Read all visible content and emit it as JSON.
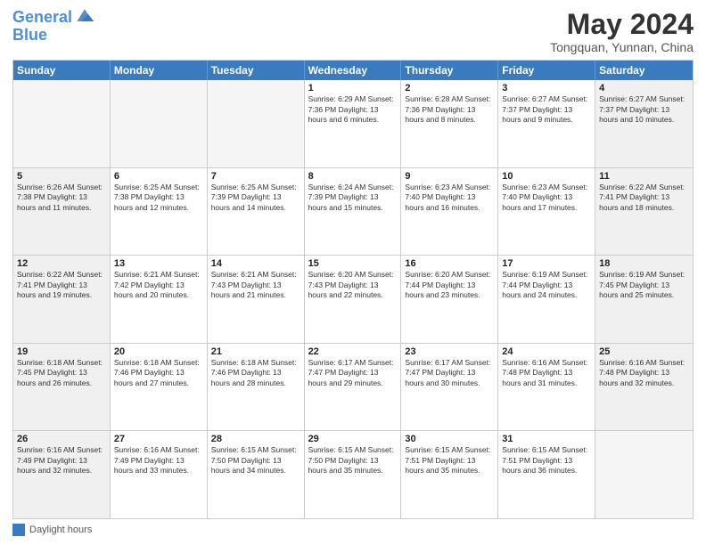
{
  "logo": {
    "line1": "General",
    "line2": "Blue"
  },
  "title": "May 2024",
  "location": "Tongquan, Yunnan, China",
  "header_days": [
    "Sunday",
    "Monday",
    "Tuesday",
    "Wednesday",
    "Thursday",
    "Friday",
    "Saturday"
  ],
  "footer": {
    "legend_label": "Daylight hours"
  },
  "weeks": [
    {
      "cells": [
        {
          "day": "",
          "content": "",
          "empty": true
        },
        {
          "day": "",
          "content": "",
          "empty": true
        },
        {
          "day": "",
          "content": "",
          "empty": true
        },
        {
          "day": "1",
          "content": "Sunrise: 6:29 AM\nSunset: 7:36 PM\nDaylight: 13 hours\nand 6 minutes.",
          "empty": false
        },
        {
          "day": "2",
          "content": "Sunrise: 6:28 AM\nSunset: 7:36 PM\nDaylight: 13 hours\nand 8 minutes.",
          "empty": false
        },
        {
          "day": "3",
          "content": "Sunrise: 6:27 AM\nSunset: 7:37 PM\nDaylight: 13 hours\nand 9 minutes.",
          "empty": false
        },
        {
          "day": "4",
          "content": "Sunrise: 6:27 AM\nSunset: 7:37 PM\nDaylight: 13 hours\nand 10 minutes.",
          "empty": false
        }
      ]
    },
    {
      "cells": [
        {
          "day": "5",
          "content": "Sunrise: 6:26 AM\nSunset: 7:38 PM\nDaylight: 13 hours\nand 11 minutes.",
          "empty": false
        },
        {
          "day": "6",
          "content": "Sunrise: 6:25 AM\nSunset: 7:38 PM\nDaylight: 13 hours\nand 12 minutes.",
          "empty": false
        },
        {
          "day": "7",
          "content": "Sunrise: 6:25 AM\nSunset: 7:39 PM\nDaylight: 13 hours\nand 14 minutes.",
          "empty": false
        },
        {
          "day": "8",
          "content": "Sunrise: 6:24 AM\nSunset: 7:39 PM\nDaylight: 13 hours\nand 15 minutes.",
          "empty": false
        },
        {
          "day": "9",
          "content": "Sunrise: 6:23 AM\nSunset: 7:40 PM\nDaylight: 13 hours\nand 16 minutes.",
          "empty": false
        },
        {
          "day": "10",
          "content": "Sunrise: 6:23 AM\nSunset: 7:40 PM\nDaylight: 13 hours\nand 17 minutes.",
          "empty": false
        },
        {
          "day": "11",
          "content": "Sunrise: 6:22 AM\nSunset: 7:41 PM\nDaylight: 13 hours\nand 18 minutes.",
          "empty": false
        }
      ]
    },
    {
      "cells": [
        {
          "day": "12",
          "content": "Sunrise: 6:22 AM\nSunset: 7:41 PM\nDaylight: 13 hours\nand 19 minutes.",
          "empty": false
        },
        {
          "day": "13",
          "content": "Sunrise: 6:21 AM\nSunset: 7:42 PM\nDaylight: 13 hours\nand 20 minutes.",
          "empty": false
        },
        {
          "day": "14",
          "content": "Sunrise: 6:21 AM\nSunset: 7:43 PM\nDaylight: 13 hours\nand 21 minutes.",
          "empty": false
        },
        {
          "day": "15",
          "content": "Sunrise: 6:20 AM\nSunset: 7:43 PM\nDaylight: 13 hours\nand 22 minutes.",
          "empty": false
        },
        {
          "day": "16",
          "content": "Sunrise: 6:20 AM\nSunset: 7:44 PM\nDaylight: 13 hours\nand 23 minutes.",
          "empty": false
        },
        {
          "day": "17",
          "content": "Sunrise: 6:19 AM\nSunset: 7:44 PM\nDaylight: 13 hours\nand 24 minutes.",
          "empty": false
        },
        {
          "day": "18",
          "content": "Sunrise: 6:19 AM\nSunset: 7:45 PM\nDaylight: 13 hours\nand 25 minutes.",
          "empty": false
        }
      ]
    },
    {
      "cells": [
        {
          "day": "19",
          "content": "Sunrise: 6:18 AM\nSunset: 7:45 PM\nDaylight: 13 hours\nand 26 minutes.",
          "empty": false
        },
        {
          "day": "20",
          "content": "Sunrise: 6:18 AM\nSunset: 7:46 PM\nDaylight: 13 hours\nand 27 minutes.",
          "empty": false
        },
        {
          "day": "21",
          "content": "Sunrise: 6:18 AM\nSunset: 7:46 PM\nDaylight: 13 hours\nand 28 minutes.",
          "empty": false
        },
        {
          "day": "22",
          "content": "Sunrise: 6:17 AM\nSunset: 7:47 PM\nDaylight: 13 hours\nand 29 minutes.",
          "empty": false
        },
        {
          "day": "23",
          "content": "Sunrise: 6:17 AM\nSunset: 7:47 PM\nDaylight: 13 hours\nand 30 minutes.",
          "empty": false
        },
        {
          "day": "24",
          "content": "Sunrise: 6:16 AM\nSunset: 7:48 PM\nDaylight: 13 hours\nand 31 minutes.",
          "empty": false
        },
        {
          "day": "25",
          "content": "Sunrise: 6:16 AM\nSunset: 7:48 PM\nDaylight: 13 hours\nand 32 minutes.",
          "empty": false
        }
      ]
    },
    {
      "cells": [
        {
          "day": "26",
          "content": "Sunrise: 6:16 AM\nSunset: 7:49 PM\nDaylight: 13 hours\nand 32 minutes.",
          "empty": false
        },
        {
          "day": "27",
          "content": "Sunrise: 6:16 AM\nSunset: 7:49 PM\nDaylight: 13 hours\nand 33 minutes.",
          "empty": false
        },
        {
          "day": "28",
          "content": "Sunrise: 6:15 AM\nSunset: 7:50 PM\nDaylight: 13 hours\nand 34 minutes.",
          "empty": false
        },
        {
          "day": "29",
          "content": "Sunrise: 6:15 AM\nSunset: 7:50 PM\nDaylight: 13 hours\nand 35 minutes.",
          "empty": false
        },
        {
          "day": "30",
          "content": "Sunrise: 6:15 AM\nSunset: 7:51 PM\nDaylight: 13 hours\nand 35 minutes.",
          "empty": false
        },
        {
          "day": "31",
          "content": "Sunrise: 6:15 AM\nSunset: 7:51 PM\nDaylight: 13 hours\nand 36 minutes.",
          "empty": false
        },
        {
          "day": "",
          "content": "",
          "empty": true
        }
      ]
    }
  ]
}
